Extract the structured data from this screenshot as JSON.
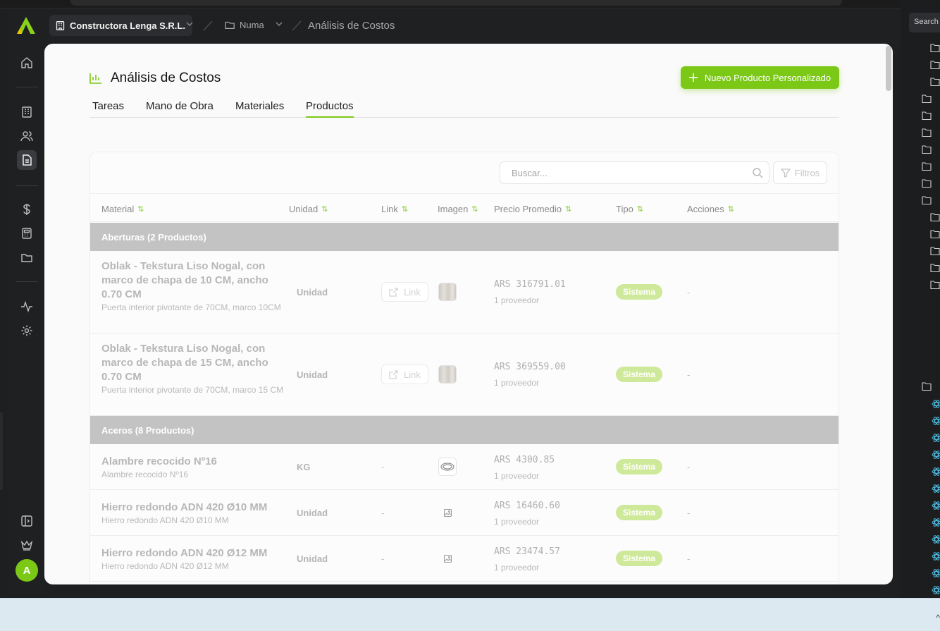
{
  "breadcrumb": {
    "company": "Constructora Lenga S.R.L.",
    "project": "Numa",
    "current": "Análisis de Costos"
  },
  "page": {
    "title": "Análisis de Costos",
    "new_button": "Nuevo Producto Personalizado"
  },
  "tabs": [
    {
      "label": "Tareas",
      "active": false
    },
    {
      "label": "Mano de Obra",
      "active": false
    },
    {
      "label": "Materiales",
      "active": false
    },
    {
      "label": "Productos",
      "active": true
    }
  ],
  "toolbar": {
    "search_placeholder": "Buscar...",
    "filter_label": "Filtros"
  },
  "table": {
    "columns": [
      "Material",
      "Unidad",
      "Link",
      "Imagen",
      "Precio Promedio",
      "Tipo",
      "Acciones"
    ],
    "groups": [
      {
        "label": "Aberturas (2 Productos)",
        "rows": [
          {
            "title": "Oblak - Tekstura Liso Nogal, con marco de chapa de 10 CM, ancho 0.70 CM",
            "desc": "Puerta interior pivotante de 70CM, marco 10CM",
            "unit": "Unidad",
            "link": "Link",
            "image": "wood",
            "price": "ARS 316791.01",
            "providers": "1 proveedor",
            "type": "Sistema",
            "actions": "-"
          },
          {
            "title": "Oblak - Tekstura Liso Nogal, con marco de chapa de 15 CM, ancho 0.70 CM",
            "desc": "Puerta interior pivotante de 70CM, marco 15 CM",
            "unit": "Unidad",
            "link": "Link",
            "image": "wood",
            "price": "ARS 369559.00",
            "providers": "1 proveedor",
            "type": "Sistema",
            "actions": "-"
          }
        ]
      },
      {
        "label": "Aceros (8 Productos)",
        "rows": [
          {
            "title": "Alambre recocido Nº16",
            "desc": "Alambre recocido Nº16",
            "unit": "KG",
            "link": "-",
            "image": "wire",
            "price": "ARS 4300.85",
            "providers": "1 proveedor",
            "type": "Sistema",
            "actions": "-"
          },
          {
            "title": "Hierro redondo ADN 420 Ø10 MM",
            "desc": "Hierro redondo ADN 420 Ø10 MM",
            "unit": "Unidad",
            "link": "-",
            "image": "placeholder",
            "price": "ARS 16460.60",
            "providers": "1 proveedor",
            "type": "Sistema",
            "actions": "-"
          },
          {
            "title": "Hierro redondo ADN 420 Ø12 MM",
            "desc": "Hierro redondo ADN 420 Ø12 MM",
            "unit": "Unidad",
            "link": "-",
            "image": "placeholder",
            "price": "ARS 23474.57",
            "providers": "1 proveedor",
            "type": "Sistema",
            "actions": "-"
          }
        ]
      }
    ]
  },
  "side_panel": {
    "search_label": "Search"
  },
  "user": {
    "avatar_initial": "A"
  },
  "colors": {
    "accent": "#7cc817",
    "badge": "#cfe99b",
    "group_header": "#c3c3c3"
  }
}
